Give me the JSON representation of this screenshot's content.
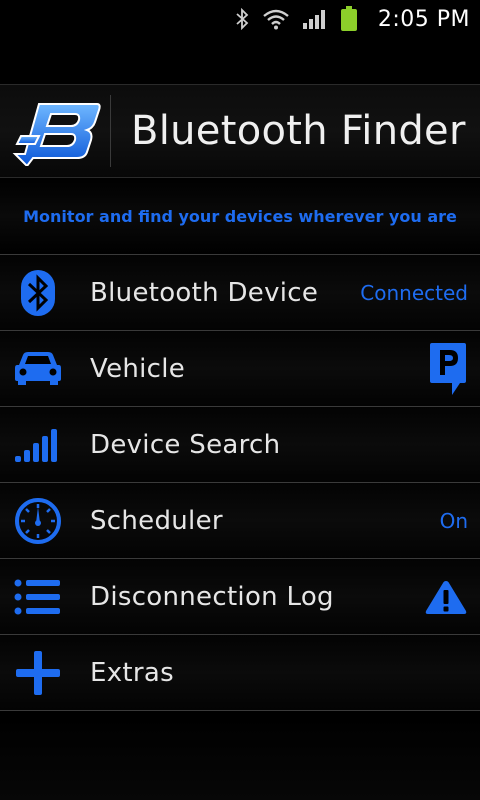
{
  "status_bar": {
    "time": "2:05 PM",
    "icons": [
      "bluetooth-icon",
      "wifi-icon",
      "signal-icon",
      "battery-icon"
    ],
    "battery_color": "#8ccf2a"
  },
  "header": {
    "title": "Bluetooth Finder",
    "logo_icon": "bluetooth-finder-logo-icon"
  },
  "tagline": "Monitor and find your devices wherever you are",
  "accent_color": "#1e6cf0",
  "menu": {
    "items": [
      {
        "label": "Bluetooth Device",
        "icon": "bluetooth-icon",
        "status": "Connected"
      },
      {
        "label": "Vehicle",
        "icon": "car-icon",
        "right_icon": "parking-icon"
      },
      {
        "label": "Device Search",
        "icon": "signal-bars-icon"
      },
      {
        "label": "Scheduler",
        "icon": "clock-icon",
        "status": "On"
      },
      {
        "label": "Disconnection Log",
        "icon": "list-icon",
        "right_icon": "warning-icon"
      },
      {
        "label": "Extras",
        "icon": "plus-icon"
      }
    ]
  }
}
